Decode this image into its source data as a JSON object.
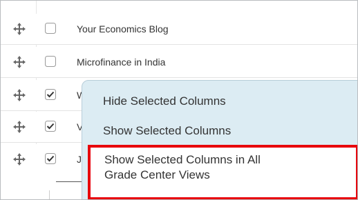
{
  "rows": [
    {
      "label": "Your Economics Blog",
      "checked": false
    },
    {
      "label": "Microfinance in India",
      "checked": false
    },
    {
      "label": "W",
      "checked": true
    },
    {
      "label": "V",
      "checked": true
    },
    {
      "label": "J",
      "checked": true
    }
  ],
  "menu": {
    "items": [
      {
        "label": "Hide Selected Columns"
      },
      {
        "label": "Show Selected Columns"
      }
    ],
    "highlighted": {
      "line1": "Show Selected Columns in All",
      "line2": "Grade Center Views"
    }
  },
  "colors": {
    "menu_bg": "#dcecf3",
    "highlight_border": "#e8000b",
    "text": "#333333"
  }
}
